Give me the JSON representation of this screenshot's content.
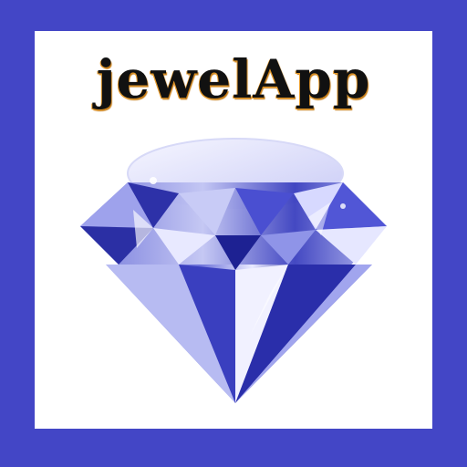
{
  "app": {
    "name": "jewelApp",
    "icon": "diamond-icon"
  },
  "colors": {
    "frame": "#4346c6",
    "card": "#ffffff",
    "title_text": "#111111",
    "title_shadow": "#e59a2b",
    "gem_light": "#e7e8ff",
    "gem_mid": "#8a8fe6",
    "gem_dark": "#1b1f8e"
  }
}
